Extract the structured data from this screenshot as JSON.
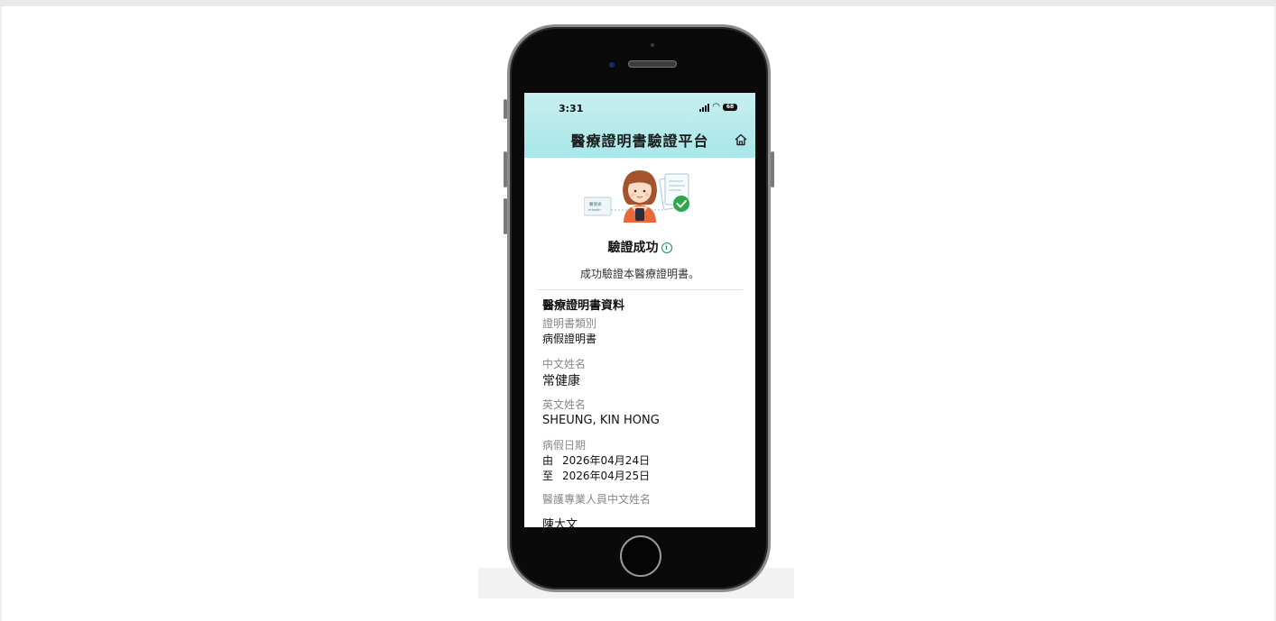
{
  "status_bar": {
    "time": "3:31",
    "battery": "68"
  },
  "header": {
    "title": "醫療證明書驗證平台"
  },
  "illustration": {
    "card_text_1": "醫健通",
    "card_text_2": "eHealth"
  },
  "result": {
    "title": "驗證成功",
    "info_symbol": "i",
    "description": "成功驗證本醫療證明書。"
  },
  "certificate": {
    "section_title": "醫療證明書資料",
    "fields": [
      {
        "label": "證明書類別",
        "value": "病假證明書"
      },
      {
        "label": "中文姓名",
        "value": "常健康"
      },
      {
        "label": "英文姓名",
        "value": "SHEUNG, KIN HONG"
      }
    ],
    "sick_leave": {
      "label": "病假日期",
      "from_key": "由",
      "from_date": "2026年04月24日",
      "to_key": "至",
      "to_date": "2026年04月25日"
    },
    "professional_label": "醫護專業人員中文姓名",
    "professional_value_partial": "陳大文"
  },
  "colors": {
    "header_gradient": "#a7e7ea",
    "success_green": "#2ea84a",
    "label_gray": "#888888"
  }
}
